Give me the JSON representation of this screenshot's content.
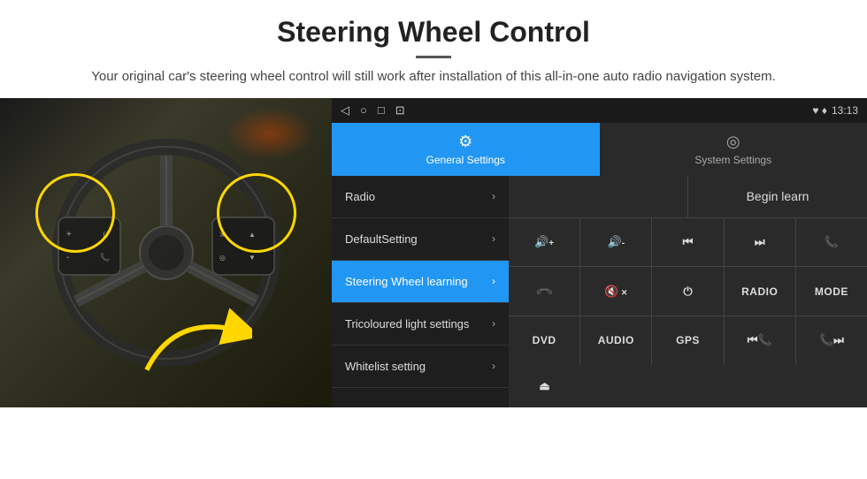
{
  "header": {
    "title": "Steering Wheel Control",
    "divider": true,
    "subtitle": "Your original car's steering wheel control will still work after installation of this all-in-one auto radio navigation system."
  },
  "status_bar": {
    "time": "13:13",
    "icons": [
      "◁",
      "○",
      "□",
      "⊡"
    ],
    "right_icons": "♥ ♦"
  },
  "tabs": [
    {
      "id": "general",
      "label": "General Settings",
      "icon": "⚙",
      "active": true
    },
    {
      "id": "system",
      "label": "System Settings",
      "icon": "◎",
      "active": false
    }
  ],
  "menu_items": [
    {
      "id": "radio",
      "label": "Radio",
      "active": false
    },
    {
      "id": "default-setting",
      "label": "DefaultSetting",
      "active": false
    },
    {
      "id": "steering-wheel",
      "label": "Steering Wheel learning",
      "active": true
    },
    {
      "id": "tricoloured",
      "label": "Tricoloured light settings",
      "active": false
    },
    {
      "id": "whitelist",
      "label": "Whitelist setting",
      "active": false
    }
  ],
  "begin_learn_label": "Begin learn",
  "control_buttons": [
    [
      "vol+",
      "vol-",
      "prev-track",
      "next-track",
      "phone"
    ],
    [
      "hang-up",
      "mute",
      "power",
      "RADIO",
      "MODE"
    ],
    [
      "DVD",
      "AUDIO",
      "GPS",
      "prev-dvd",
      "next-dvd"
    ]
  ],
  "control_button_labels": {
    "vol_plus": "🔊+",
    "vol_minus": "🔊-",
    "prev_track": "⏮",
    "next_track": "⏭",
    "phone": "📞",
    "hang_up": "📞",
    "mute_x": "🔇",
    "power": "⏻",
    "RADIO": "RADIO",
    "MODE": "MODE",
    "DVD": "DVD",
    "AUDIO": "AUDIO",
    "GPS": "GPS",
    "prev_dvd": "⏮📞",
    "next_dvd": "⏭📞",
    "eject": "⏏"
  }
}
